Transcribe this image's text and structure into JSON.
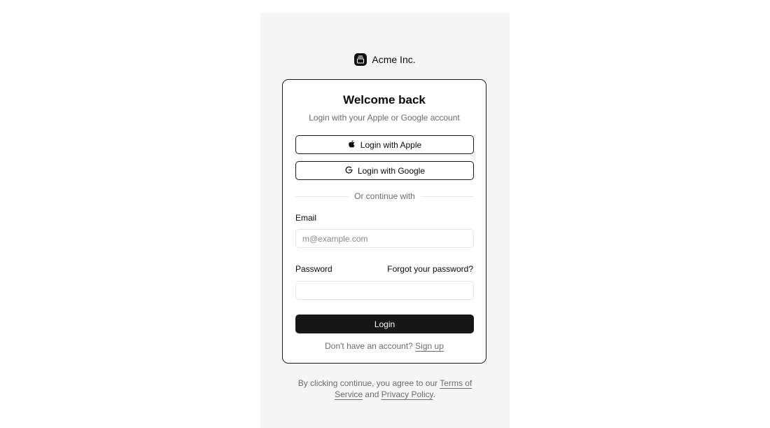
{
  "brand": {
    "name": "Acme Inc."
  },
  "card": {
    "title": "Welcome back",
    "subtitle": "Login with your Apple or Google account",
    "apple_button": "Login with Apple",
    "google_button": "Login with Google",
    "divider_text": "Or continue with",
    "email_label": "Email",
    "email_placeholder": "m@example.com",
    "email_value": "",
    "password_label": "Password",
    "password_value": "",
    "forgot_link": "Forgot your password?",
    "login_button": "Login",
    "signup_prompt": "Don't have an account?",
    "signup_link": "Sign up"
  },
  "footer": {
    "prefix": "By clicking continue, you agree to our",
    "terms_link": "Terms of Service",
    "and_text": "and",
    "privacy_link": "Privacy Policy",
    "suffix": "."
  },
  "icons": {
    "brand": "gallery-vertical-end-icon",
    "apple": "apple-icon",
    "google": "google-icon"
  },
  "colors": {
    "frame_background": "#f5f5f5",
    "primary_button": "#171717",
    "muted_text": "#6b6b6b"
  }
}
